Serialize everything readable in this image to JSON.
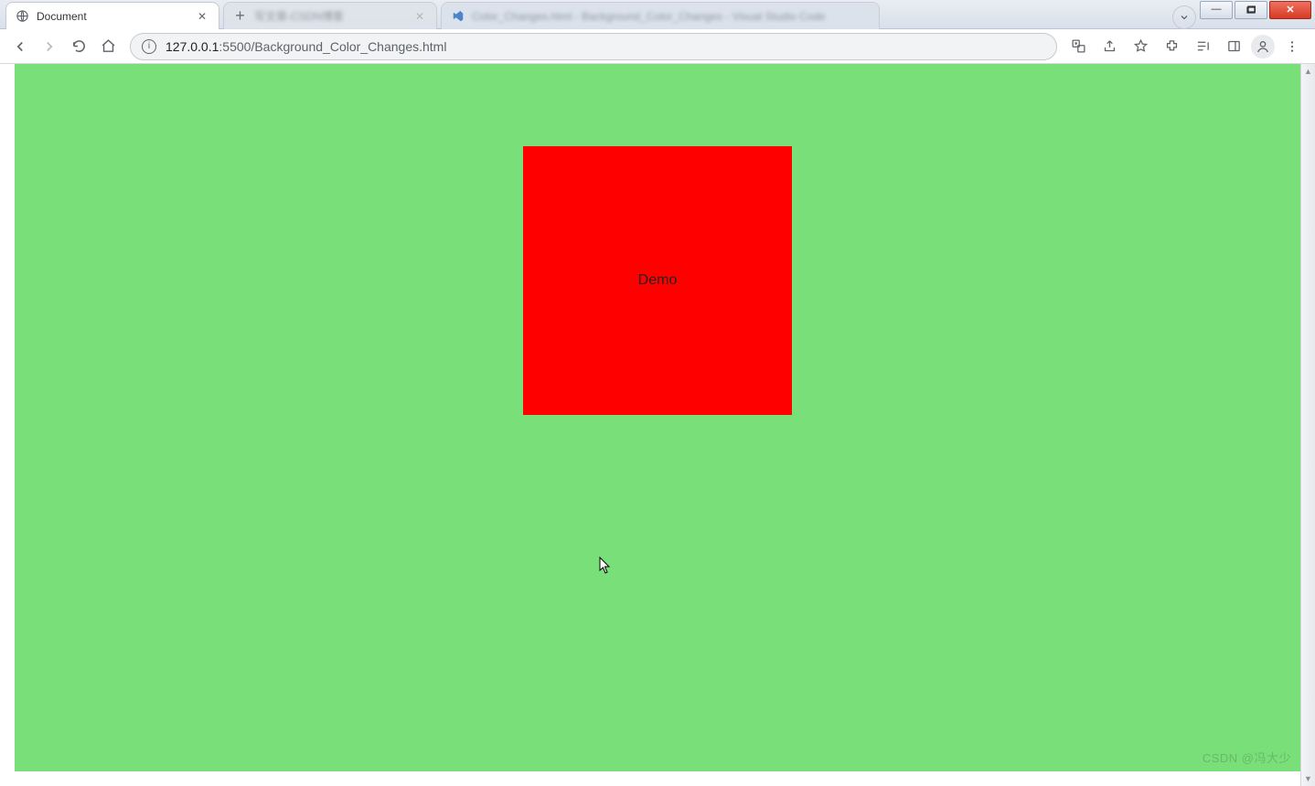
{
  "tabs": [
    {
      "title": "Document",
      "favicon": "globe",
      "active": true
    },
    {
      "title": "写文章-CSDN博客",
      "favicon": "plus",
      "active": false
    },
    {
      "title": "Color_Changes.html - Background_Color_Changes - Visual Studio Code",
      "favicon": "vsc",
      "active": false
    }
  ],
  "address": {
    "host": "127.0.0.1",
    "port": ":5500",
    "path": "/Background_Color_Changes.html"
  },
  "page": {
    "body_background": "#79e079",
    "box_background": "#ff0000",
    "box_text": "Demo"
  },
  "watermark": "CSDN @冯大少"
}
